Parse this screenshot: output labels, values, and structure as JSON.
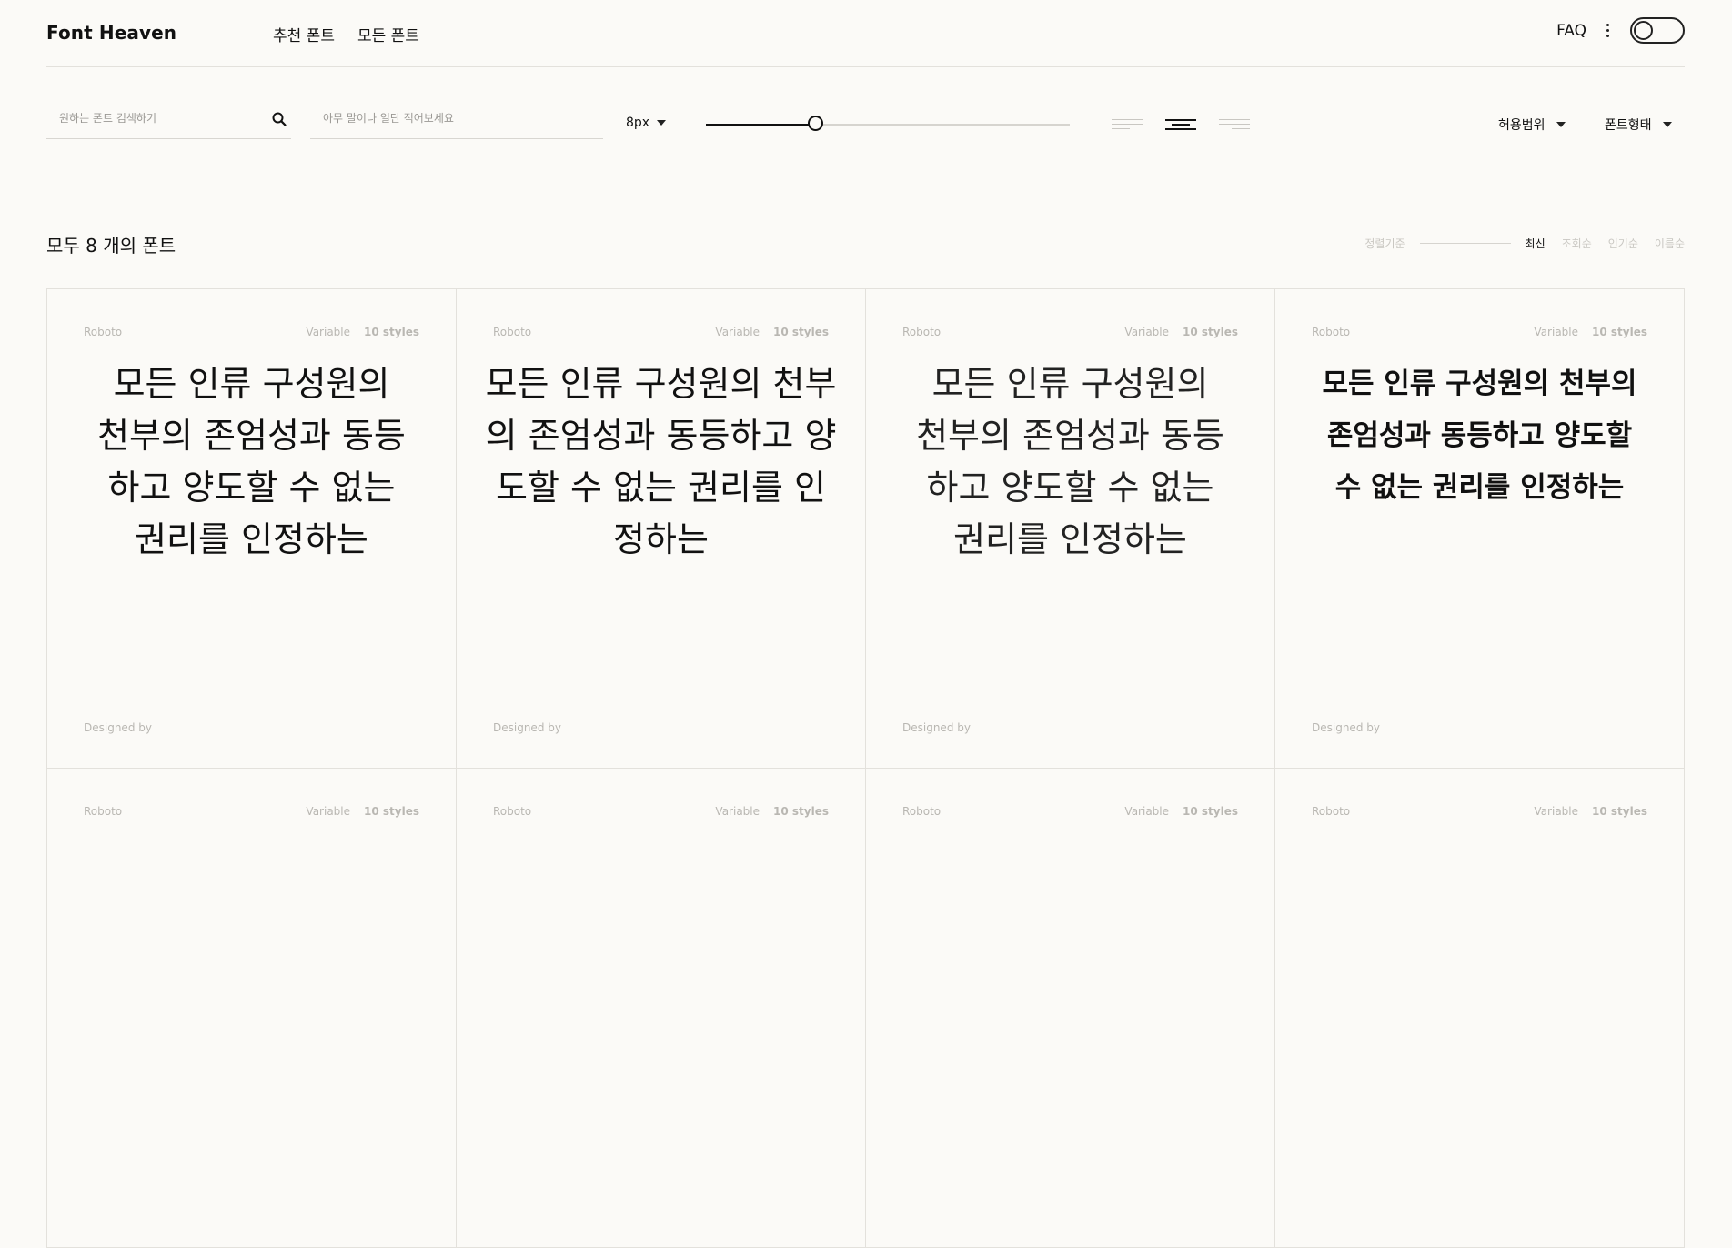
{
  "header": {
    "logo": "Font Heaven",
    "nav": [
      "추천 폰트",
      "모든 폰트"
    ],
    "faq": "FAQ"
  },
  "toolbar": {
    "search_placeholder": "원하는 폰트 검색하기",
    "text_placeholder": "아무 말이나 일단 적어보세요",
    "size_value": "8px",
    "slider_level": 0.3,
    "align_active": "center",
    "license_label": "허용범위",
    "type_label": "폰트형태"
  },
  "listing": {
    "count_text": "모두 8 개의 폰트",
    "sort_label": "정렬기준",
    "sort_options": [
      "최신",
      "조회순",
      "인기순",
      "이름순"
    ],
    "sort_active": "최신"
  },
  "cards": [
    {
      "font": "Roboto",
      "variable": "Variable",
      "styles": "10 styles",
      "sample": "모든 인류 구성원의 천부의 존엄성과 동등하고 양도할 수 없는 권리를 인정하는",
      "designer": "Designed by"
    },
    {
      "font": "Roboto",
      "variable": "Variable",
      "styles": "10 styles",
      "sample": "모든 인류 구성원의 천부의 존엄성과 동등하고 양도할 수 없는 권리를 인정하는",
      "designer": "Designed by"
    },
    {
      "font": "Roboto",
      "variable": "Variable",
      "styles": "10 styles",
      "sample": "모든 인류 구성원의 천부의 존엄성과 동등하고 양도할 수 없는 권리를 인정하는",
      "designer": "Designed by"
    },
    {
      "font": "Roboto",
      "variable": "Variable",
      "styles": "10 styles",
      "sample": "모든 인류 구성원의 천부의 존엄성과 동등하고 양도할 수 없는 권리를 인정하는",
      "designer": "Designed by"
    },
    {
      "font": "Roboto",
      "variable": "Variable",
      "styles": "10 styles",
      "sample": "",
      "designer": ""
    },
    {
      "font": "Roboto",
      "variable": "Variable",
      "styles": "10 styles",
      "sample": "",
      "designer": ""
    },
    {
      "font": "Roboto",
      "variable": "Variable",
      "styles": "10 styles",
      "sample": "",
      "designer": ""
    },
    {
      "font": "Roboto",
      "variable": "Variable",
      "styles": "10 styles",
      "sample": "",
      "designer": ""
    }
  ]
}
